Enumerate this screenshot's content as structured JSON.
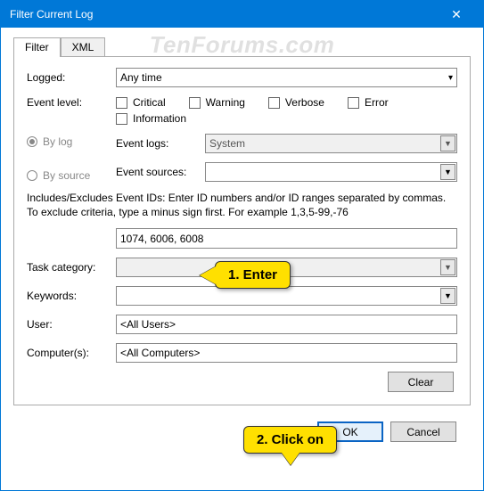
{
  "watermark": "TenForums.com",
  "window": {
    "title": "Filter Current Log",
    "close": "✕"
  },
  "tabs": {
    "filter": "Filter",
    "xml": "XML"
  },
  "logged": {
    "label": "Logged:",
    "value": "Any time"
  },
  "event_level": {
    "label": "Event level:",
    "items": [
      "Critical",
      "Warning",
      "Verbose",
      "Error",
      "Information"
    ]
  },
  "radios": {
    "bylog": "By log",
    "bysource": "By source"
  },
  "event_logs": {
    "label": "Event logs:",
    "value": "System"
  },
  "event_sources": {
    "label": "Event sources:",
    "value": ""
  },
  "ids_help": "Includes/Excludes Event IDs: Enter ID numbers and/or ID ranges separated by commas. To exclude criteria, type a minus sign first. For example 1,3,5-99,-76",
  "ids_value": "1074, 6006, 6008",
  "task_category": {
    "label": "Task category:",
    "value": ""
  },
  "keywords": {
    "label": "Keywords:",
    "value": ""
  },
  "user": {
    "label": "User:",
    "value": "<All Users>"
  },
  "computers": {
    "label": "Computer(s):",
    "value": "<All Computers>"
  },
  "buttons": {
    "clear": "Clear",
    "ok": "OK",
    "cancel": "Cancel"
  },
  "callouts": {
    "enter": "1. Enter",
    "click": "2. Click on"
  }
}
